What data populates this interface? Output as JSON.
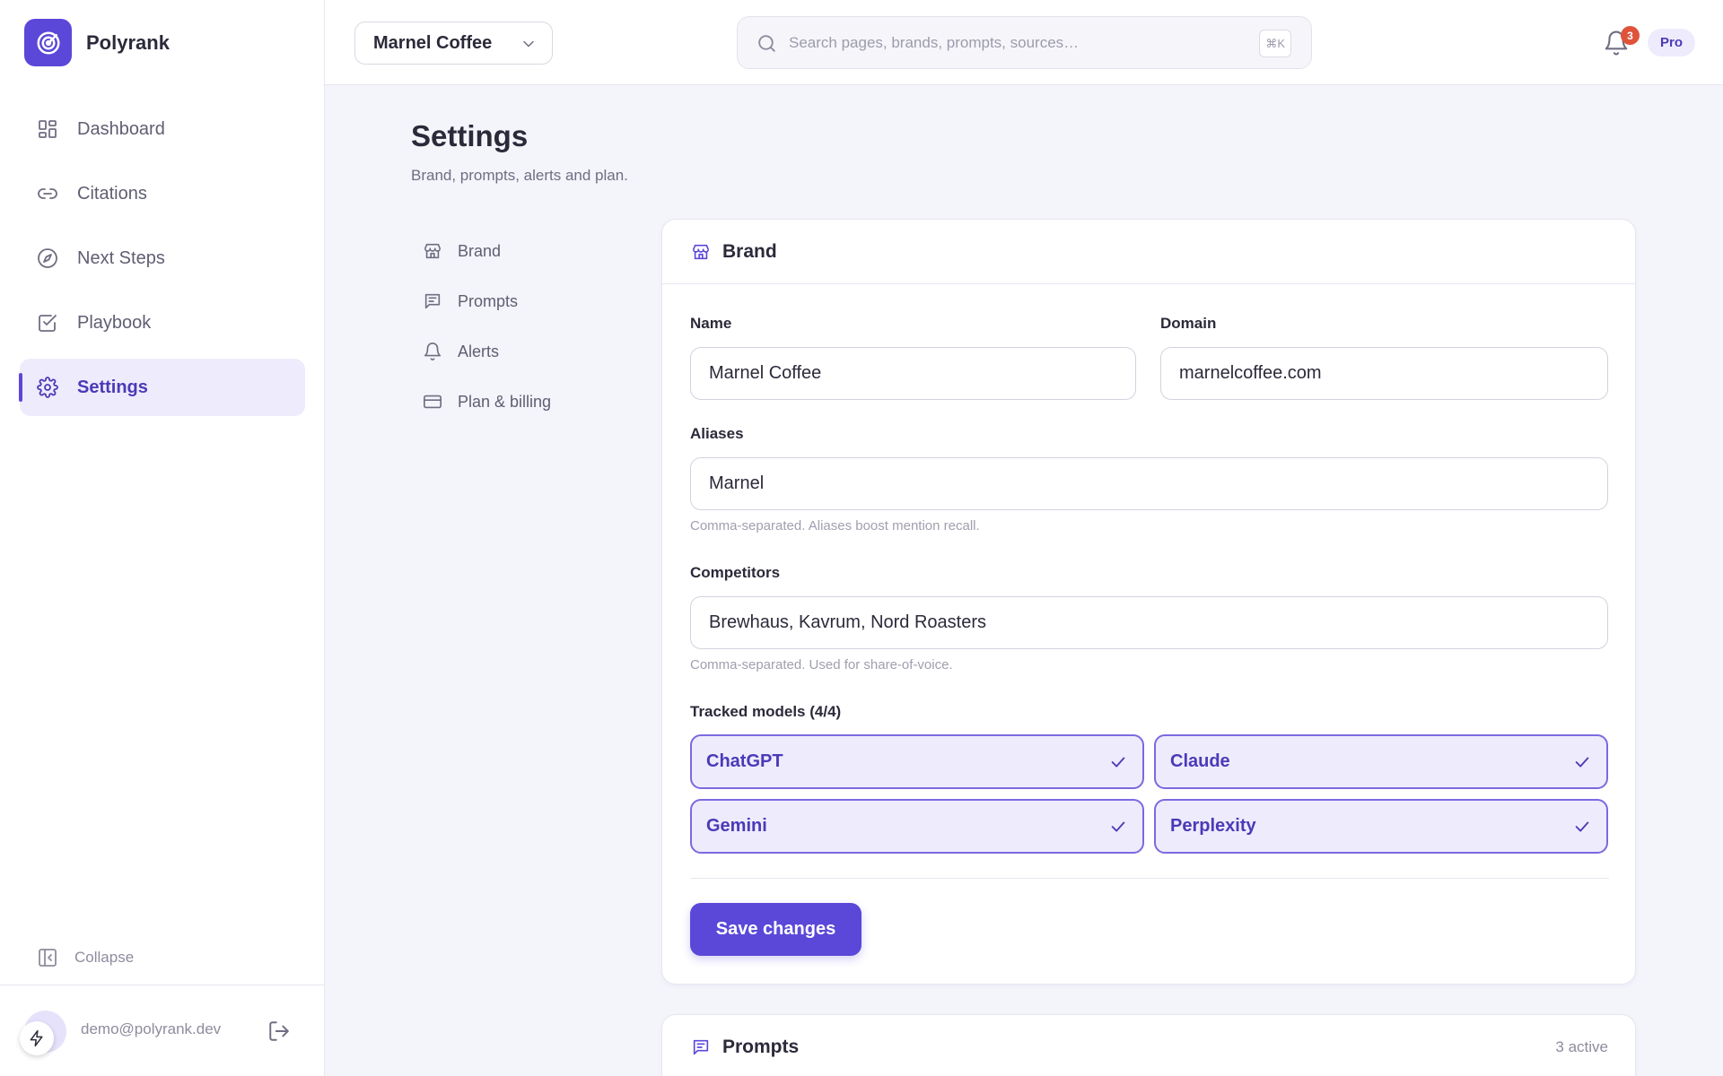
{
  "app": {
    "name": "Polyrank"
  },
  "sidebar": {
    "items": [
      {
        "label": "Dashboard",
        "icon": "grid-icon"
      },
      {
        "label": "Citations",
        "icon": "link-icon"
      },
      {
        "label": "Next Steps",
        "icon": "compass-icon"
      },
      {
        "label": "Playbook",
        "icon": "checkbox-icon"
      },
      {
        "label": "Settings",
        "icon": "gear-icon",
        "active": true
      }
    ],
    "collapse_label": "Collapse",
    "user_email": "demo@polyrank.dev"
  },
  "topbar": {
    "brand_select": "Marnel Coffee",
    "search_placeholder": "Search pages, brands, prompts, sources…",
    "search_shortcut": "⌘K",
    "notification_count": "3",
    "plan": "Pro"
  },
  "page": {
    "title": "Settings",
    "subtitle": "Brand, prompts, alerts and plan."
  },
  "subnav": {
    "items": [
      {
        "label": "Brand",
        "icon": "store-icon"
      },
      {
        "label": "Prompts",
        "icon": "message-icon"
      },
      {
        "label": "Alerts",
        "icon": "bell-icon"
      },
      {
        "label": "Plan & billing",
        "icon": "card-icon"
      }
    ]
  },
  "brand_card": {
    "title": "Brand",
    "name_label": "Name",
    "name_value": "Marnel Coffee",
    "domain_label": "Domain",
    "domain_value": "marnelcoffee.com",
    "aliases_label": "Aliases",
    "aliases_value": "Marnel",
    "aliases_hint": "Comma-separated. Aliases boost mention recall.",
    "competitors_label": "Competitors",
    "competitors_value": "Brewhaus, Kavrum, Nord Roasters",
    "competitors_hint": "Comma-separated. Used for share-of-voice.",
    "models_label": "Tracked models (4/4)",
    "models": [
      {
        "label": "ChatGPT",
        "checked": true
      },
      {
        "label": "Claude",
        "checked": true
      },
      {
        "label": "Gemini",
        "checked": true
      },
      {
        "label": "Perplexity",
        "checked": true
      }
    ],
    "save_label": "Save changes"
  },
  "prompts_card": {
    "title": "Prompts",
    "meta": "3 active"
  },
  "colors": {
    "accent": "#5b48d8",
    "accent_light": "#eeebfc",
    "notification": "#e0533b"
  }
}
